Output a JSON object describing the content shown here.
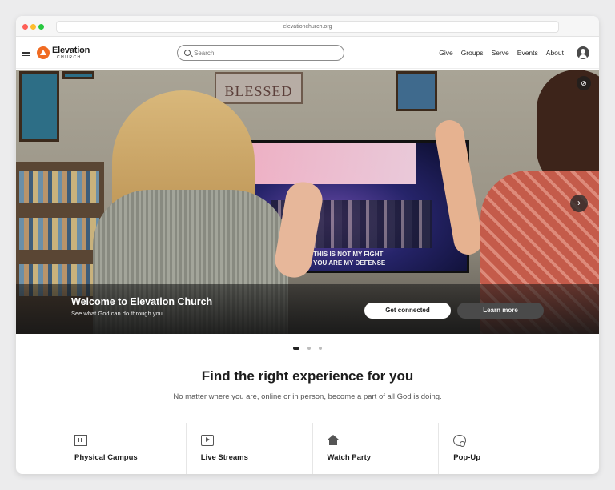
{
  "browser": {
    "url": "elevationchurch.org"
  },
  "brand": {
    "name": "Elevation",
    "sub": "CHURCH"
  },
  "search": {
    "placeholder": "Search"
  },
  "nav": {
    "links": [
      "Give",
      "Groups",
      "Serve",
      "Events",
      "About"
    ]
  },
  "hero": {
    "sign_text": "BLESSED",
    "tv_caption_1": "THIS IS NOT MY FIGHT",
    "tv_caption_2": "YOU ARE MY DEFENSE",
    "title": "Welcome to Elevation Church",
    "subtitle": "See what God can do through you.",
    "primary_button": "Get connected",
    "secondary_button": "Learn more",
    "slide_count": 3,
    "active_slide": 1
  },
  "experience": {
    "title": "Find the right experience for you",
    "subtitle": "No matter where you are, online or in person, become a part of all God is doing.",
    "cards": [
      {
        "label": "Physical Campus",
        "icon": "building-icon"
      },
      {
        "label": "Live Streams",
        "icon": "play-icon"
      },
      {
        "label": "Watch Party",
        "icon": "home-icon"
      },
      {
        "label": "Pop-Up",
        "icon": "globe-search-icon"
      }
    ]
  },
  "colors": {
    "brand_orange": "#f06b22",
    "hero_overlay": "#1e1e1e",
    "accent_dark": "#222222"
  }
}
